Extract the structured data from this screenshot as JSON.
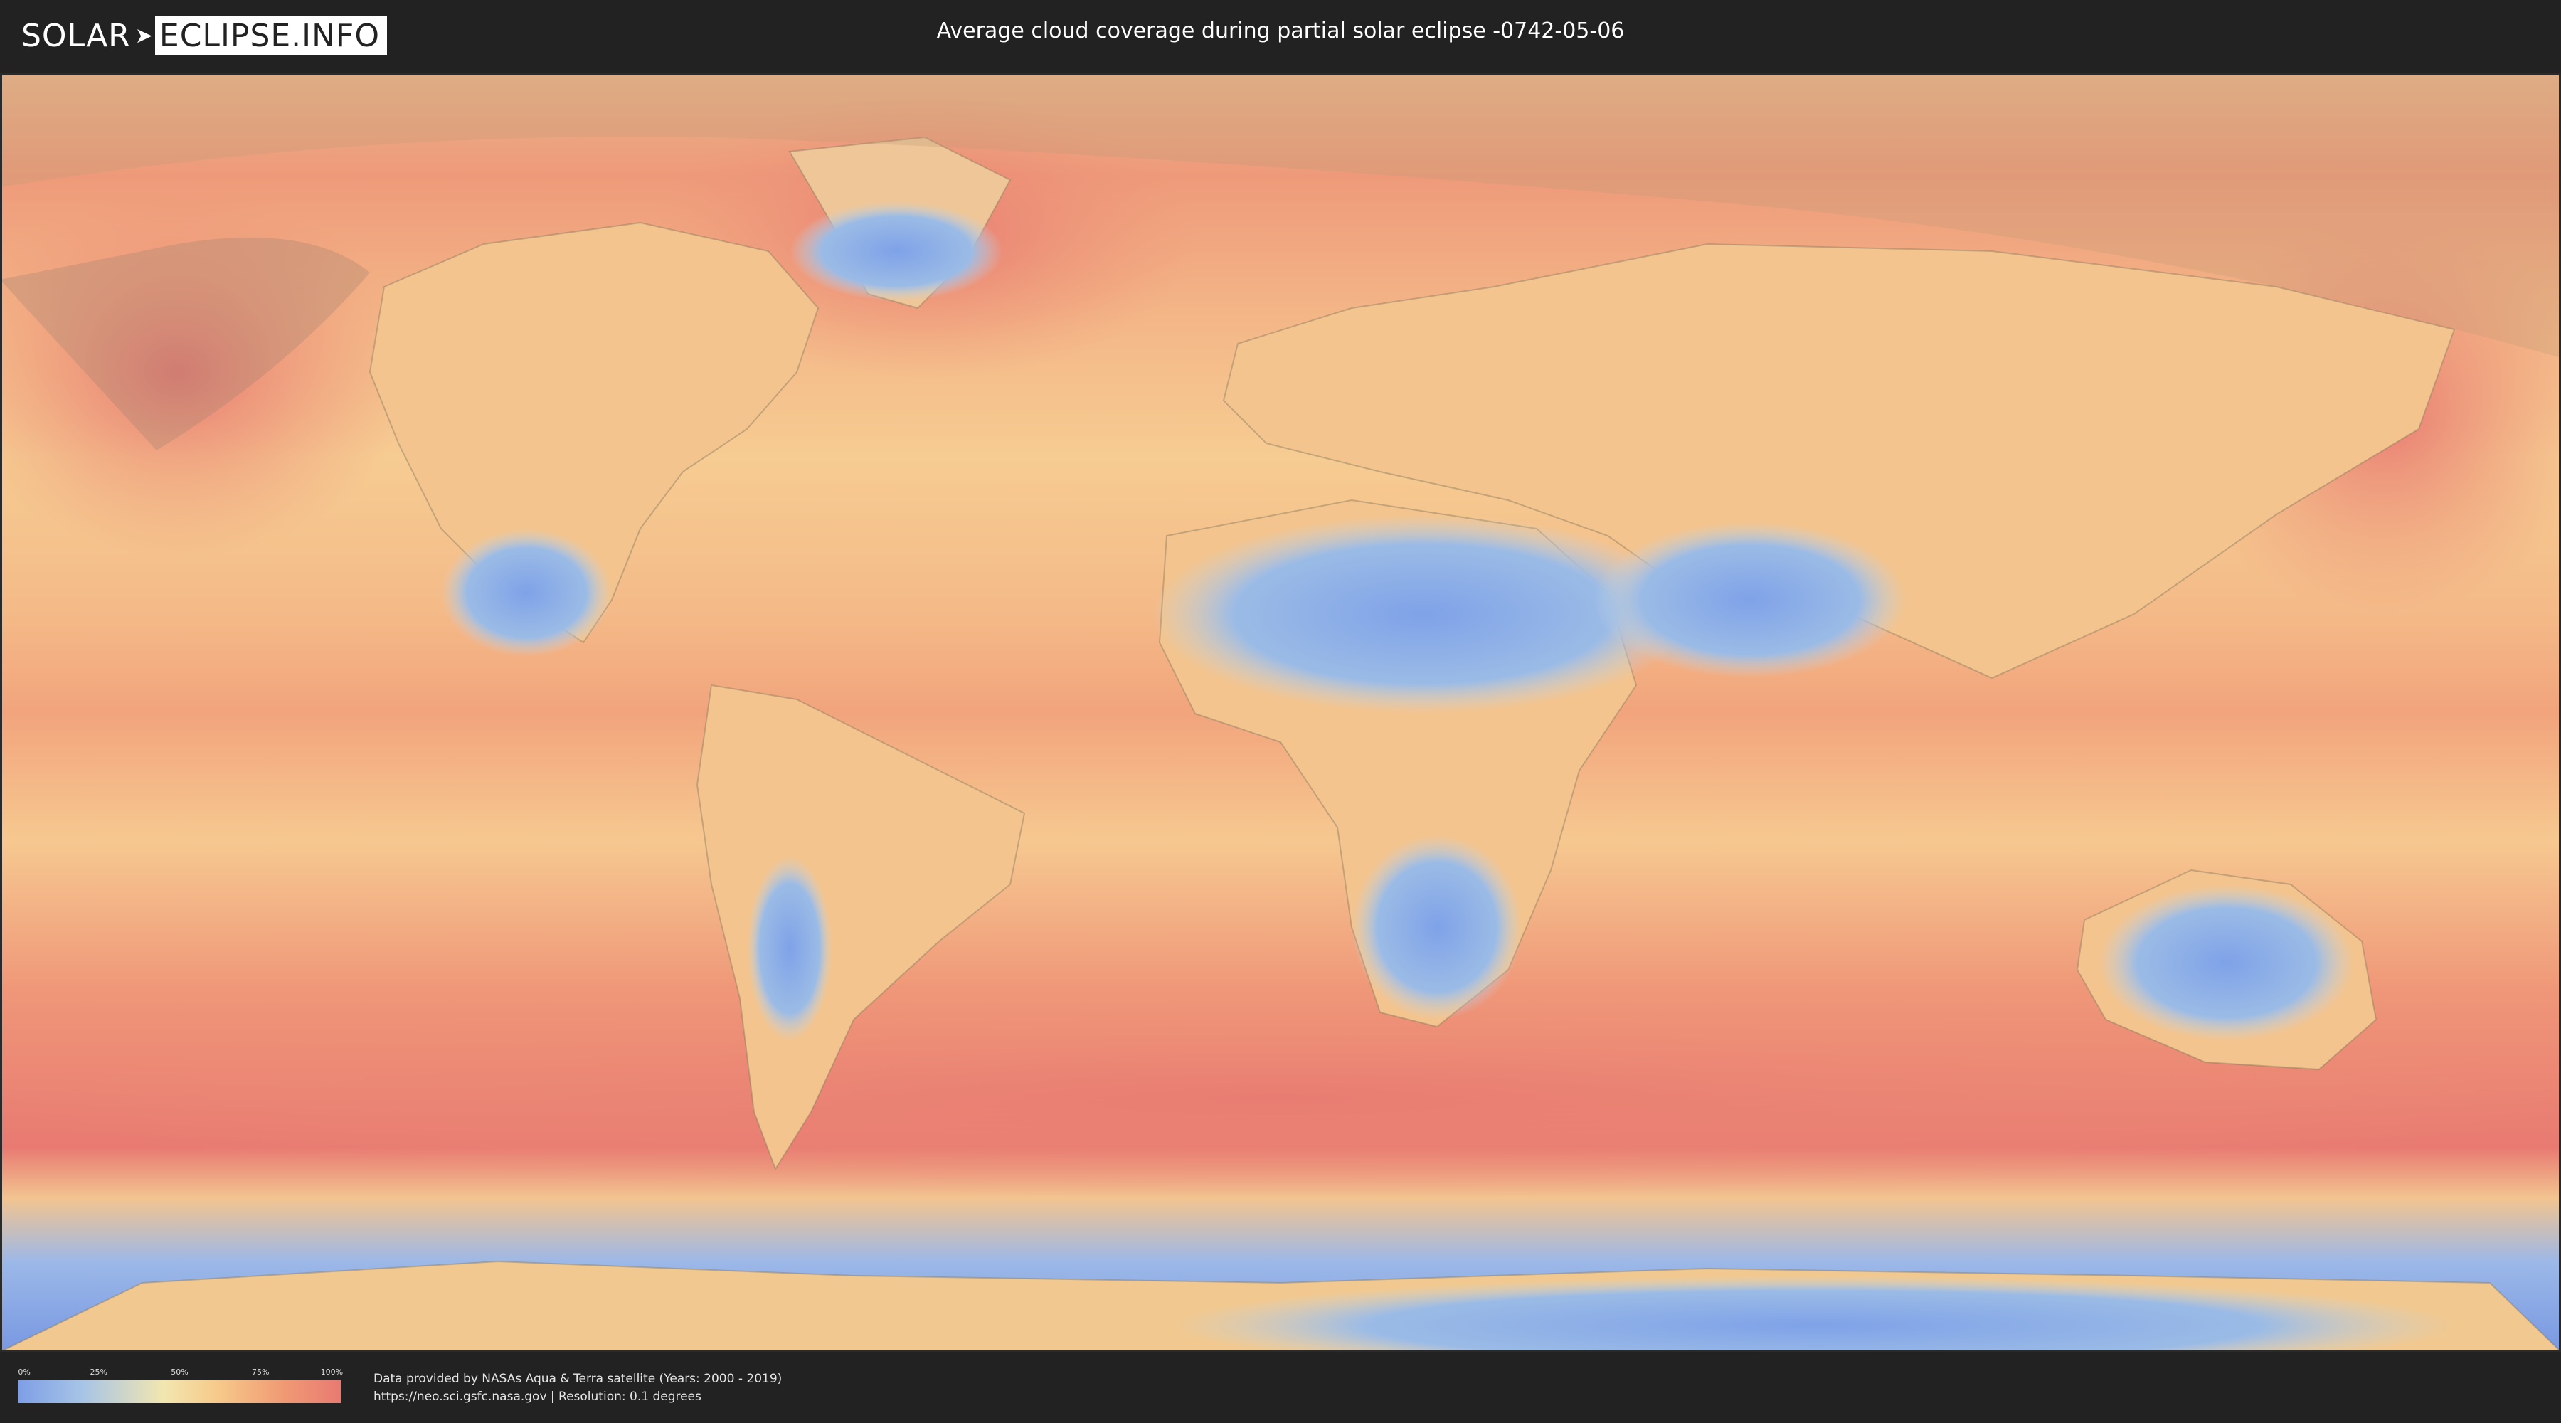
{
  "header": {
    "logo_solar": "SOLAR",
    "logo_eclipse": "ECLIPSE.INFO",
    "title": "Average cloud coverage during partial solar eclipse -0742-05-06"
  },
  "map": {
    "description_layer": "cloud coverage",
    "colors": {
      "low": "#7d9ee6",
      "mid": "#f2e6b0",
      "high": "#e87a72"
    }
  },
  "legend": {
    "labels": [
      "0%",
      "25%",
      "50%",
      "75%",
      "100%"
    ]
  },
  "footer": {
    "credit_line1": "Data provided by NASAs Aqua & Terra satellite (Years: 2000 - 2019)",
    "credit_line2": "https://neo.sci.gsfc.nasa.gov | Resolution: 0.1 degrees"
  }
}
